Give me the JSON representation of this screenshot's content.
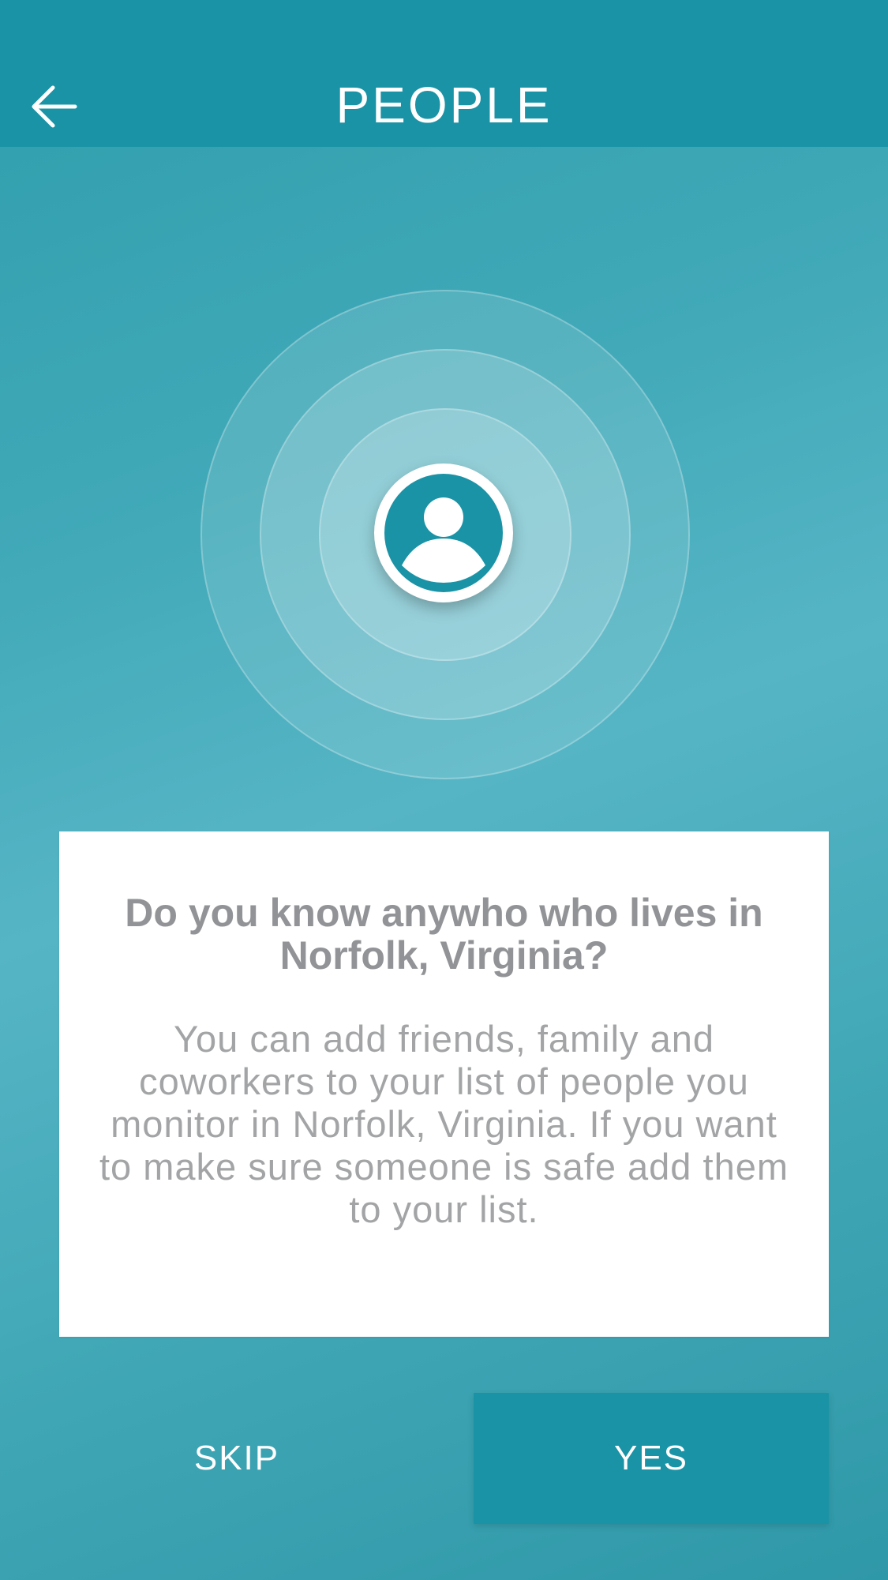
{
  "header": {
    "title": "PEOPLE",
    "back_icon": "arrow-left-icon"
  },
  "illustration": {
    "icon": "person-icon"
  },
  "card": {
    "heading": "Do you know anywho who lives in Norfolk, Virginia?",
    "body": "You can add friends, family and coworkers to your list of people you monitor in Norfolk, Virginia. If you want to make sure someone is safe add them to your list."
  },
  "actions": {
    "skip_label": "SKIP",
    "yes_label": "YES"
  },
  "colors": {
    "header": "#1a93a6",
    "accent": "#1a93a6",
    "card_text": "#929396",
    "background": "#44aab9"
  }
}
